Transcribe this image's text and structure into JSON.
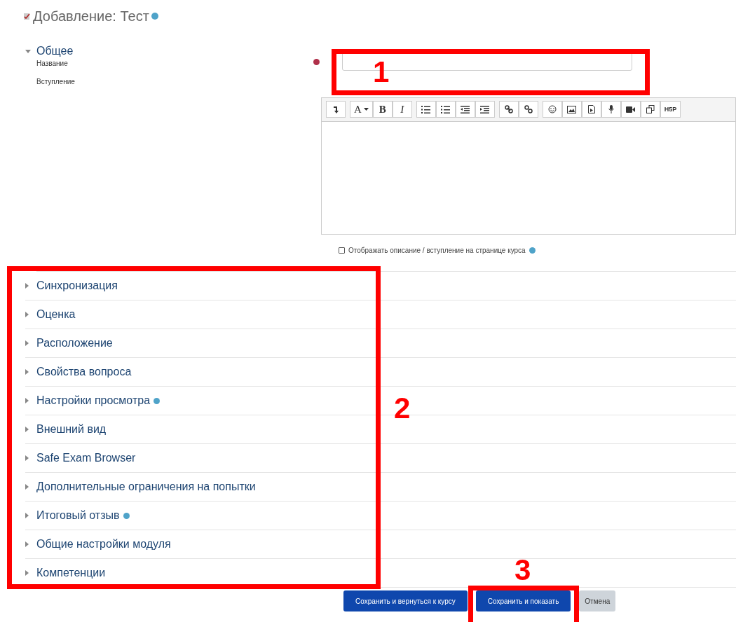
{
  "page_title": {
    "text": "Добавление: Тест",
    "help": true
  },
  "general": {
    "title": "Общее",
    "expanded": true,
    "name_field": {
      "label": "Название",
      "required": true
    },
    "intro_field": {
      "label": "Вступление",
      "toolbar": [
        [
          {
            "kind": "redo"
          }
        ],
        [
          {
            "kind": "font",
            "label": "A"
          },
          {
            "kind": "bold",
            "label": "B"
          },
          {
            "kind": "italic",
            "label": "I"
          }
        ],
        [
          {
            "kind": "bullets"
          },
          {
            "kind": "numbers"
          },
          {
            "kind": "outdent"
          },
          {
            "kind": "indent"
          }
        ],
        [
          {
            "kind": "link"
          },
          {
            "kind": "unlink"
          }
        ],
        [
          {
            "kind": "emoji"
          },
          {
            "kind": "image"
          },
          {
            "kind": "media"
          },
          {
            "kind": "mic"
          },
          {
            "kind": "video"
          },
          {
            "kind": "copy"
          },
          {
            "kind": "h5p",
            "label": "H5P"
          }
        ]
      ]
    },
    "show_description": {
      "label": "Отображать описание / вступление на странице курса",
      "checked": false,
      "help": true
    }
  },
  "sections": [
    {
      "title": "Синхронизация",
      "expanded": false,
      "help": false
    },
    {
      "title": "Оценка",
      "expanded": false,
      "help": false
    },
    {
      "title": "Расположение",
      "expanded": false,
      "help": false
    },
    {
      "title": "Свойства вопроса",
      "expanded": false,
      "help": false
    },
    {
      "title": "Настройки просмотра",
      "expanded": false,
      "help": true
    },
    {
      "title": "Внешний вид",
      "expanded": false,
      "help": false
    },
    {
      "title": "Safe Exam Browser",
      "expanded": false,
      "help": false
    },
    {
      "title": "Дополнительные ограничения на попытки",
      "expanded": false,
      "help": false
    },
    {
      "title": "Итоговый отзыв",
      "expanded": false,
      "help": true
    },
    {
      "title": "Общие настройки модуля",
      "expanded": false,
      "help": false
    },
    {
      "title": "Компетенции",
      "expanded": false,
      "help": false
    }
  ],
  "buttons": [
    {
      "label": "Сохранить и вернуться к курсу",
      "kind": "primary"
    },
    {
      "label": "Сохранить и показать",
      "kind": "primary"
    },
    {
      "label": "Отмена",
      "kind": "secondary"
    }
  ],
  "annotations": [
    {
      "label": "1"
    },
    {
      "label": "2"
    },
    {
      "label": "3"
    }
  ]
}
